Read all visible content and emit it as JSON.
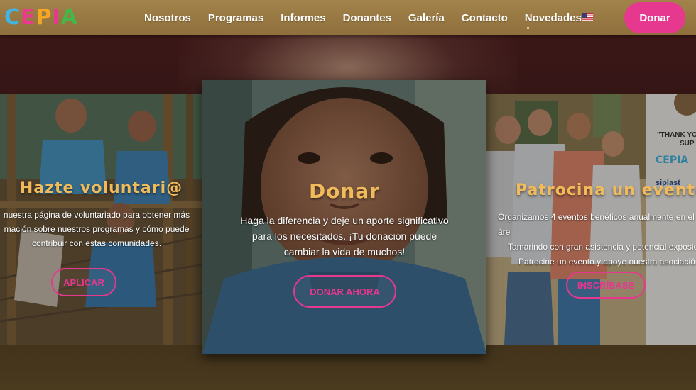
{
  "brand": {
    "letters": [
      "C",
      "E",
      "P",
      "I",
      "A"
    ],
    "letter_colors": [
      "#3fb6e6",
      "#ea3a8f",
      "#f5a623",
      "#e6388f",
      "#45b649"
    ]
  },
  "nav": {
    "items": [
      "Nosotros",
      "Programas",
      "Informes",
      "Donantes",
      "Galería",
      "Contacto",
      "Novedades"
    ],
    "language_flag": "us-flag-icon",
    "donate_label": "Donar"
  },
  "cards": {
    "left": {
      "title": "Hazte voluntari@",
      "lines": [
        "nuestra página de voluntariado para obtener más",
        "mación sobre nuestros programas y cómo puede",
        "contribuir con estas comunidades."
      ],
      "button": "APLICAR"
    },
    "center": {
      "title": "Donar",
      "lines": [
        "Haga la diferencia y deje un aporte significativo",
        "para los necesitados. ¡Tu donación puede",
        "cambiar la vida de muchos!"
      ],
      "button": "DONAR AHORA"
    },
    "right": {
      "title": "Patrocina un evento",
      "lines": [
        "Organizamos 4 eventos benéficos anualmente en el áre",
        "Tamarindo con gran asistencia y potencial exposició",
        "Patrocine un evento y apoye nuestra asociación."
      ],
      "button": "INSCRÍBASE",
      "banner_text": [
        "\"THANK YO",
        "SUP",
        "CEPIA",
        "siplast"
      ]
    }
  },
  "colors": {
    "accent": "#e6388f",
    "title_gold": "#f1bb5c",
    "topbar": "#9a7a44"
  }
}
